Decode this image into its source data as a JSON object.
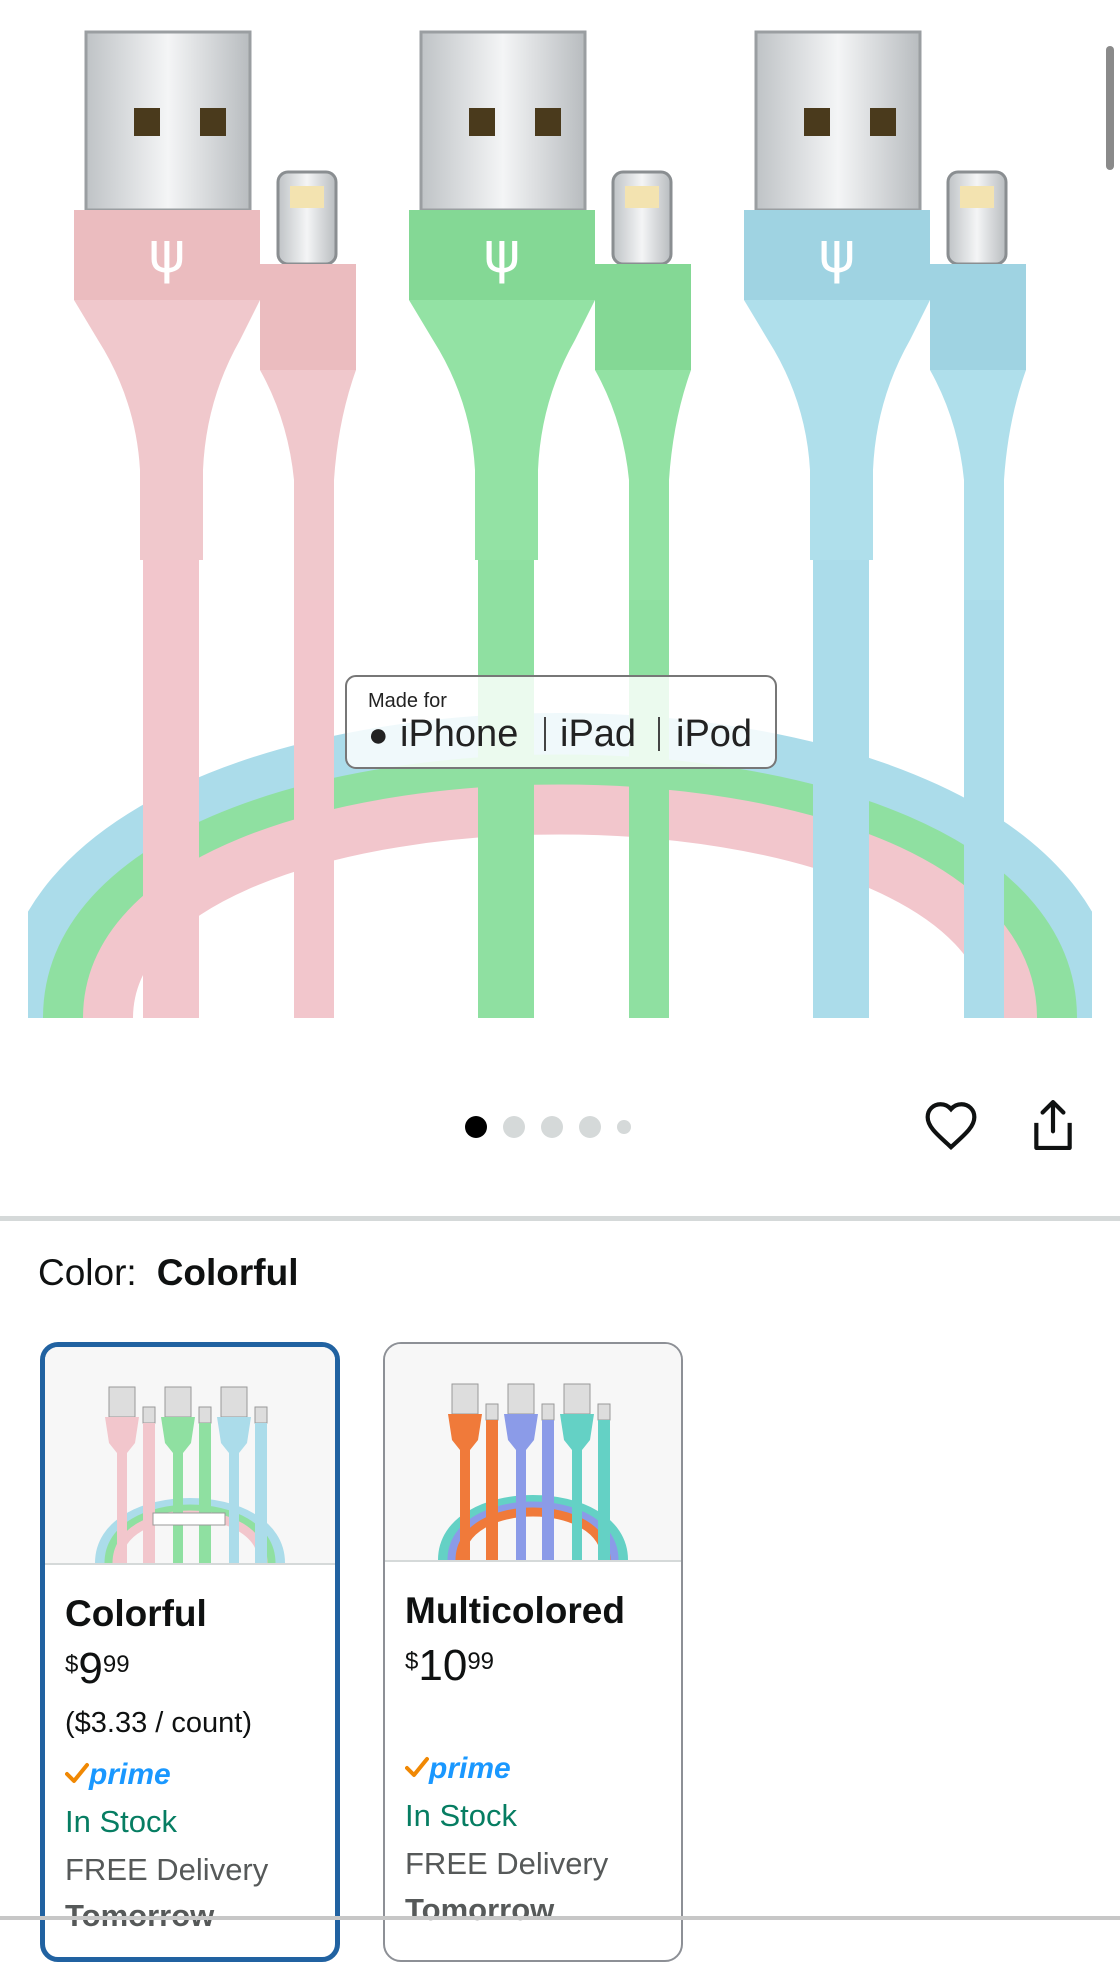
{
  "image_badge": {
    "made_for": "Made for",
    "devices": [
      "iPhone",
      "iPad",
      "iPod"
    ]
  },
  "carousel": {
    "count": 5,
    "active_index": 0
  },
  "icons": {
    "favorite": "heart-icon",
    "share": "share-icon"
  },
  "color_selector": {
    "label": "Color:",
    "selected": "Colorful"
  },
  "options": [
    {
      "name": "Colorful",
      "price_symbol": "$",
      "price_whole": "9",
      "price_cents": "99",
      "unit_price": "($3.33 / count)",
      "prime": "prime",
      "stock": "In Stock",
      "delivery": "FREE Delivery",
      "delivery_day": "Tomorrow",
      "selected": true
    },
    {
      "name": "Multicolored",
      "price_symbol": "$",
      "price_whole": "10",
      "price_cents": "99",
      "prime": "prime",
      "stock": "In Stock",
      "delivery": "FREE Delivery",
      "delivery_day": "Tomorrow",
      "selected": false
    }
  ],
  "colors": {
    "pink": "#f2c6cc",
    "green": "#8fe0a1",
    "blue": "#abdcea",
    "prime_blue": "#1a98ff",
    "prime_check": "#f08804",
    "stock_green": "#067d62",
    "selected_border": "#2162a1"
  }
}
